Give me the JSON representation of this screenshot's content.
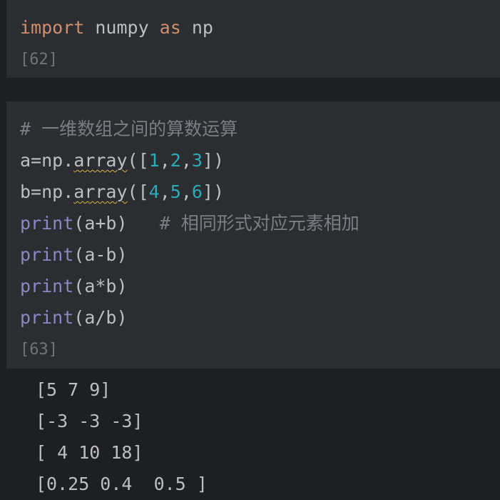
{
  "cells": [
    {
      "code": {
        "import_kw": "import",
        "module": " numpy ",
        "as_kw": "as",
        "alias": " np"
      },
      "exec_count": "[62]"
    },
    {
      "comment_line": "# 一维数组之间的算数运算",
      "lines": [
        {
          "prefix": "a=np.",
          "call": "array",
          "open": "([",
          "n1": "1",
          "c1": ",",
          "n2": "2",
          "c2": ",",
          "n3": "3",
          "close": "])"
        },
        {
          "prefix": "b=np.",
          "call": "array",
          "open": "([",
          "n1": "4",
          "c1": ",",
          "n2": "5",
          "c2": ",",
          "n3": "6",
          "close": "])"
        }
      ],
      "prints": [
        {
          "fn": "print",
          "args": "(a+b)",
          "spacer": "   ",
          "comment": "# 相同形式对应元素相加"
        },
        {
          "fn": "print",
          "args": "(a-b)"
        },
        {
          "fn": "print",
          "args": "(a*b)"
        },
        {
          "fn": "print",
          "args": "(a/b)"
        }
      ],
      "exec_count": "[63]"
    }
  ],
  "outputs": [
    "[5 7 9]",
    "[-3 -3 -3]",
    "[ 4 10 18]",
    "[0.25 0.4  0.5 ]"
  ],
  "colors": {
    "background": "#1e1f22",
    "cell_background": "#2b2d30",
    "text": "#bcbec4",
    "keyword": "#cf8e6d",
    "builtin": "#8888c6",
    "number": "#2aacb8",
    "comment": "#7a7e85",
    "warning_underline": "#d7b34a"
  }
}
